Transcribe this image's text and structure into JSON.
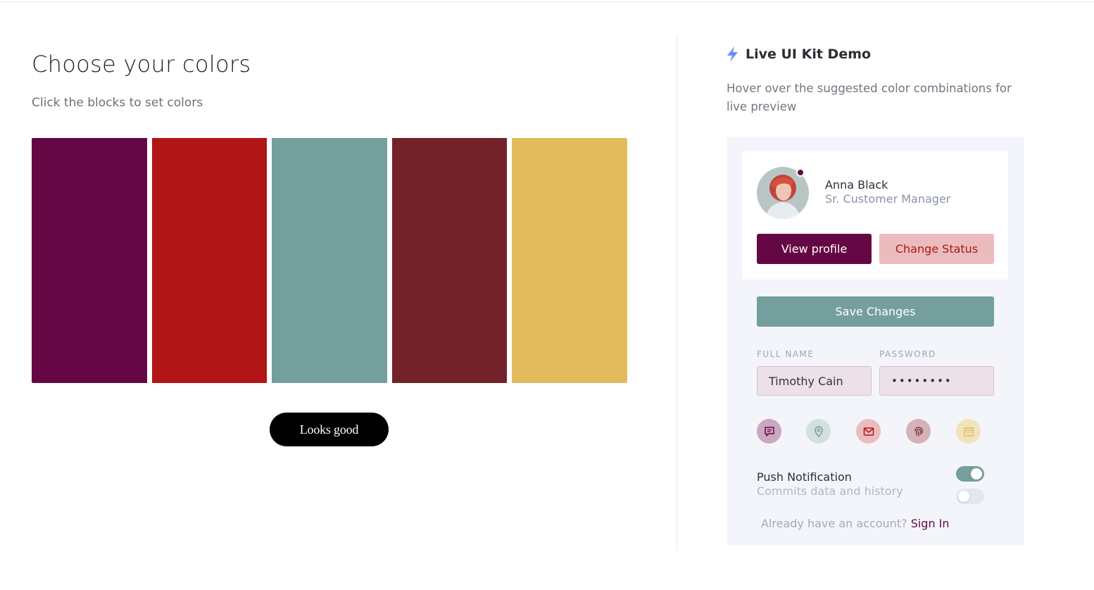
{
  "colors": {
    "swatch_1": "#660745",
    "swatch_2": "#B11515",
    "swatch_3": "#749F9D",
    "swatch_4": "#74222A",
    "swatch_5": "#E1BB5C",
    "primary": "#660745",
    "danger_text": "#B11515",
    "danger_bg": "#EBBCBE",
    "accent": "#749F9D",
    "bolt": "#6D8CF2"
  },
  "picker": {
    "title": "Choose your colors",
    "subtitle": "Click the blocks to set colors",
    "confirm_label": "Looks good"
  },
  "demo": {
    "title": "Live UI Kit Demo",
    "description": "Hover over the suggested color combinations for live preview",
    "profile": {
      "name": "Anna Black",
      "role": "Sr. Customer Manager",
      "view_label": "View profile",
      "status_label": "Change Status"
    },
    "save_label": "Save Changes",
    "form": {
      "full_name_label": "FULL NAME",
      "full_name_value": "Timothy Cain",
      "password_label": "PASSWORD",
      "password_value": "••••••••"
    },
    "icons": [
      "chat-icon",
      "location-pin-icon",
      "mail-icon",
      "fingerprint-icon",
      "calendar-icon"
    ],
    "push": {
      "title": "Push Notification",
      "subtitle": "Commits data and history",
      "toggle_1_on": true,
      "toggle_2_on": false
    },
    "signin": {
      "prompt": "Already have an account?",
      "link": "Sign In"
    }
  }
}
